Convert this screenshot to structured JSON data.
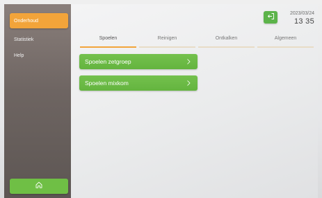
{
  "sidebar": {
    "items": [
      {
        "label": "Onderhoud"
      },
      {
        "label": "Statistiek"
      },
      {
        "label": "Help"
      }
    ]
  },
  "header": {
    "date": "2023/03/24",
    "time": "13 35"
  },
  "tabs": [
    {
      "label": "Spoelen"
    },
    {
      "label": "Reinigen"
    },
    {
      "label": "Ontkalken"
    },
    {
      "label": "Algemeen"
    }
  ],
  "menu": {
    "items": [
      {
        "label": "Spoelen zetgroep"
      },
      {
        "label": "Spoelen mixkom"
      }
    ]
  },
  "colors": {
    "accent_orange": "#f2a43a",
    "accent_green": "#6fbf45",
    "sidebar_bg": "#6e6562"
  },
  "icons": {
    "home": "home-icon",
    "logout": "logout-icon",
    "chevron": "chevron-right-icon"
  }
}
